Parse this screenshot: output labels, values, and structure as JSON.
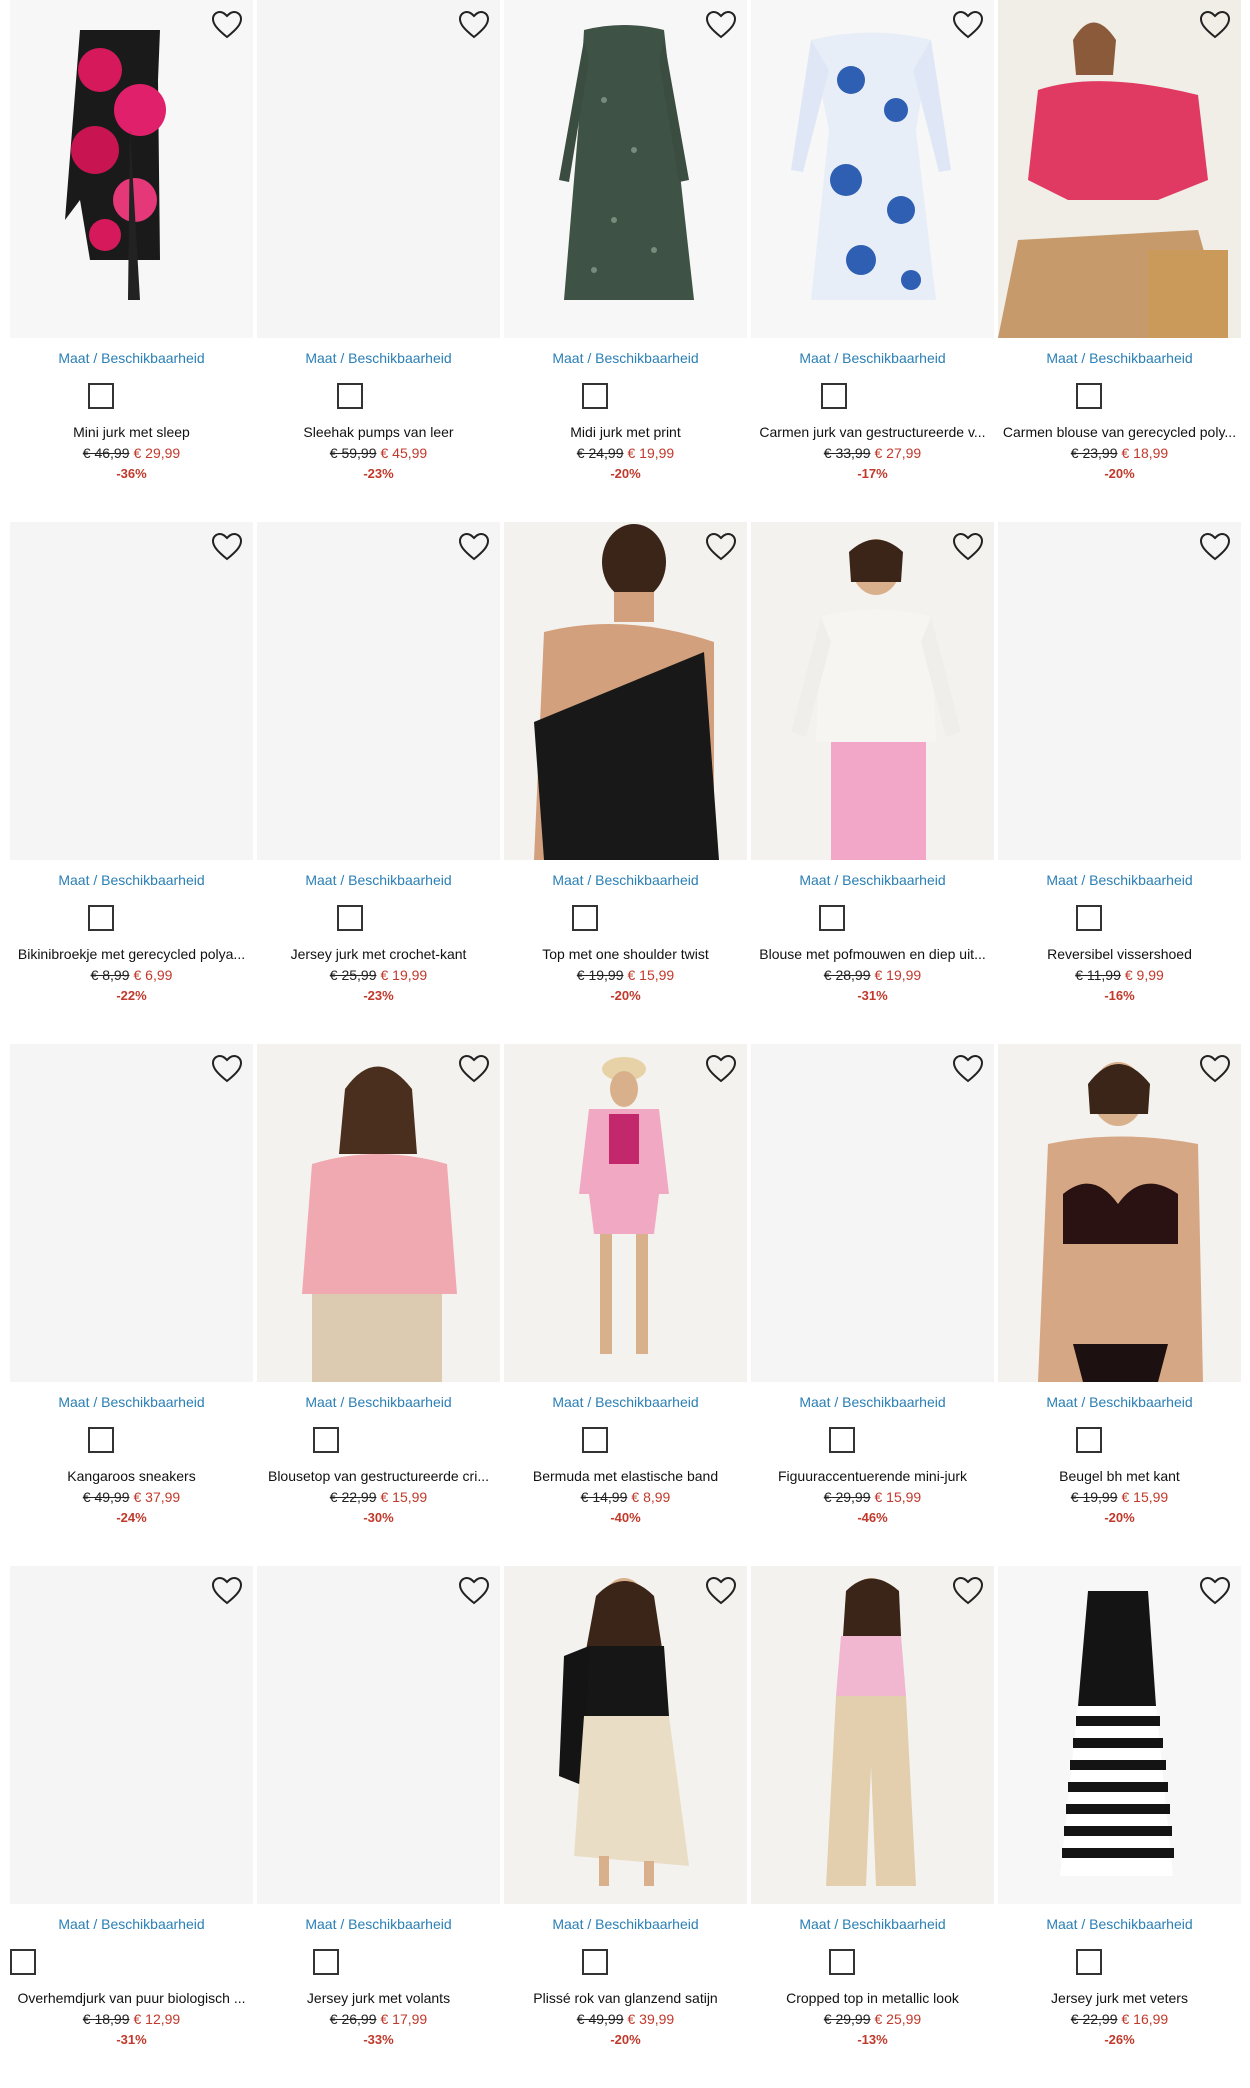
{
  "ui": {
    "maat_label": "Maat / Beschikbaarheid",
    "wishlist_icon": "heart-outline-icon",
    "accent_link": "#2a7fb5",
    "price_red": "#c0392b"
  },
  "products": [
    {
      "name": "Mini jurk met sleep",
      "old_price": "€ 46,99",
      "new_price": "€ 29,99",
      "discount": "-36%",
      "has_image": true,
      "art": "floral-dress"
    },
    {
      "name": "Sleehak pumps van leer",
      "old_price": "€ 59,99",
      "new_price": "€ 45,99",
      "discount": "-23%",
      "has_image": false,
      "art": "none"
    },
    {
      "name": "Midi jurk met print",
      "old_price": "€ 24,99",
      "new_price": "€ 19,99",
      "discount": "-20%",
      "has_image": true,
      "art": "green-dress"
    },
    {
      "name": "Carmen jurk van gestructureerde v...",
      "old_price": "€ 33,99",
      "new_price": "€ 27,99",
      "discount": "-17%",
      "has_image": true,
      "art": "blue-paisley-dress"
    },
    {
      "name": "Carmen blouse van gerecycled poly...",
      "old_price": "€ 23,99",
      "new_price": "€ 18,99",
      "discount": "-20%",
      "has_image": true,
      "art": "pink-blouse-model"
    },
    {
      "name": "Bikinibroekje met gerecycled polya...",
      "old_price": "€ 8,99",
      "new_price": "€ 6,99",
      "discount": "-22%",
      "has_image": false,
      "art": "none"
    },
    {
      "name": "Jersey jurk met crochet-kant",
      "old_price": "€ 25,99",
      "new_price": "€ 19,99",
      "discount": "-23%",
      "has_image": false,
      "art": "none"
    },
    {
      "name": "Top met one shoulder twist",
      "old_price": "€ 19,99",
      "new_price": "€ 15,99",
      "discount": "-20%",
      "has_image": true,
      "art": "black-top-model"
    },
    {
      "name": "Blouse met pofmouwen en diep uit...",
      "old_price": "€ 28,99",
      "new_price": "€ 19,99",
      "discount": "-31%",
      "has_image": true,
      "art": "white-blouse-model"
    },
    {
      "name": "Reversibel vissershoed",
      "old_price": "€ 11,99",
      "new_price": "€ 9,99",
      "discount": "-16%",
      "has_image": false,
      "art": "none"
    },
    {
      "name": "Kangaroos sneakers",
      "old_price": "€ 49,99",
      "new_price": "€ 37,99",
      "discount": "-24%",
      "has_image": false,
      "art": "none"
    },
    {
      "name": "Blousetop van gestructureerde cri...",
      "old_price": "€ 22,99",
      "new_price": "€ 15,99",
      "discount": "-30%",
      "has_image": true,
      "art": "pink-top-model"
    },
    {
      "name": "Bermuda met elastische band",
      "old_price": "€ 14,99",
      "new_price": "€ 8,99",
      "discount": "-40%",
      "has_image": true,
      "art": "pink-shorts-model"
    },
    {
      "name": "Figuuraccentuerende mini-jurk",
      "old_price": "€ 29,99",
      "new_price": "€ 15,99",
      "discount": "-46%",
      "has_image": false,
      "art": "none"
    },
    {
      "name": "Beugel bh met kant",
      "old_price": "€ 19,99",
      "new_price": "€ 15,99",
      "discount": "-20%",
      "has_image": true,
      "art": "bra-model"
    },
    {
      "name": "Overhemdjurk van puur biologisch ...",
      "old_price": "€ 18,99",
      "new_price": "€ 12,99",
      "discount": "-31%",
      "has_image": false,
      "art": "none"
    },
    {
      "name": "Jersey jurk met volants",
      "old_price": "€ 26,99",
      "new_price": "€ 17,99",
      "discount": "-33%",
      "has_image": false,
      "art": "none"
    },
    {
      "name": "Plissé rok van glanzend satijn",
      "old_price": "€ 49,99",
      "new_price": "€ 39,99",
      "discount": "-20%",
      "has_image": true,
      "art": "skirt-model"
    },
    {
      "name": "Cropped top in metallic look",
      "old_price": "€ 29,99",
      "new_price": "€ 25,99",
      "discount": "-13%",
      "has_image": true,
      "art": "beige-pants-model"
    },
    {
      "name": "Jersey jurk met veters",
      "old_price": "€ 22,99",
      "new_price": "€ 16,99",
      "discount": "-26%",
      "has_image": true,
      "art": "striped-dress"
    }
  ]
}
